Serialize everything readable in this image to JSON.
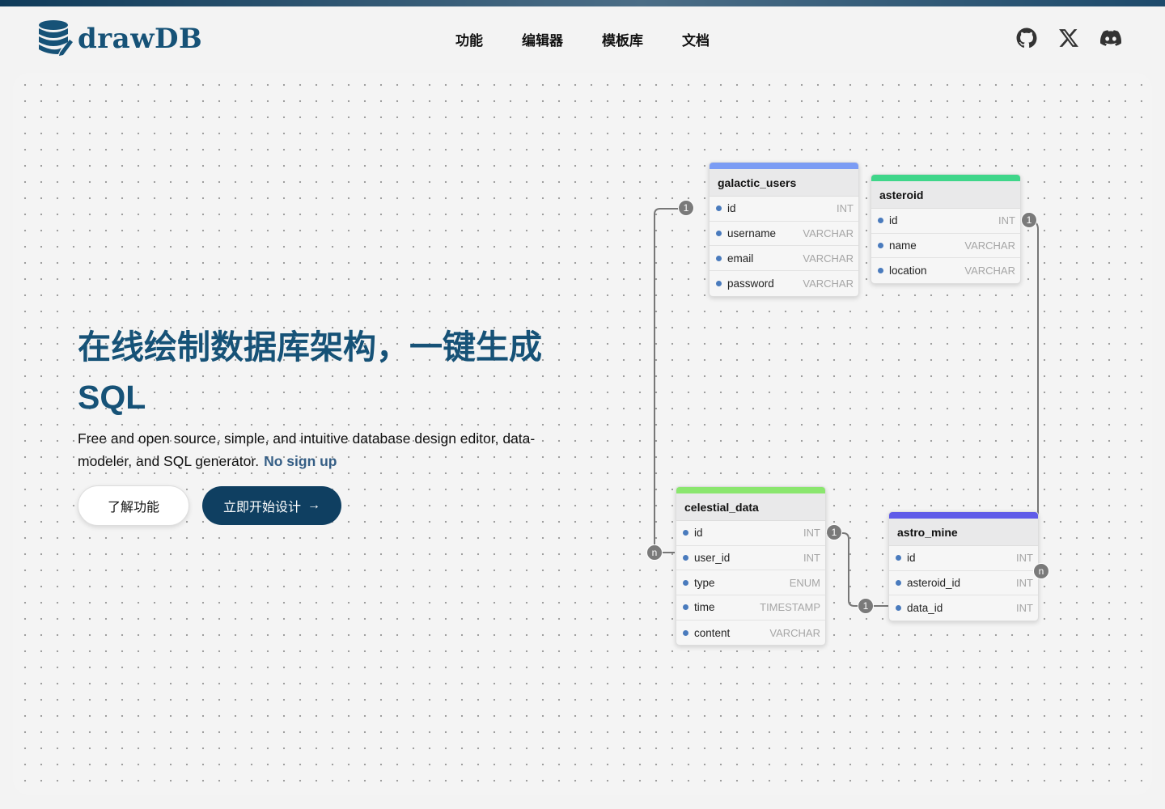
{
  "brand": {
    "name": "drawDB"
  },
  "nav": {
    "items": [
      "功能",
      "编辑器",
      "模板库",
      "文档"
    ]
  },
  "social": [
    "github-icon",
    "x-icon",
    "discord-icon"
  ],
  "hero": {
    "title": "在线绘制数据库架构，一键生成 SQL",
    "description": "Free and open source, simple, and intuitive database design editor, data-modeler, and SQL generator.",
    "highlight": "No sign up",
    "secondary_button": "了解功能",
    "primary_button": "立即开始设计"
  },
  "colors": {
    "brand": "#165277",
    "primary_button": "#0f3f61"
  },
  "diagram": {
    "tables": [
      {
        "name": "galactic_users",
        "color": "#7b9cf4",
        "fields": [
          {
            "name": "id",
            "type": "INT"
          },
          {
            "name": "username",
            "type": "VARCHAR"
          },
          {
            "name": "email",
            "type": "VARCHAR"
          },
          {
            "name": "password",
            "type": "VARCHAR"
          }
        ]
      },
      {
        "name": "asteroid",
        "color": "#3fd68a",
        "fields": [
          {
            "name": "id",
            "type": "INT"
          },
          {
            "name": "name",
            "type": "VARCHAR"
          },
          {
            "name": "location",
            "type": "VARCHAR"
          }
        ]
      },
      {
        "name": "celestial_data",
        "color": "#8ae66e",
        "fields": [
          {
            "name": "id",
            "type": "INT"
          },
          {
            "name": "user_id",
            "type": "INT"
          },
          {
            "name": "type",
            "type": "ENUM"
          },
          {
            "name": "time",
            "type": "TIMESTAMP"
          },
          {
            "name": "content",
            "type": "VARCHAR"
          }
        ]
      },
      {
        "name": "astro_mine",
        "color": "#5f5be8",
        "fields": [
          {
            "name": "id",
            "type": "INT"
          },
          {
            "name": "asteroid_id",
            "type": "INT"
          },
          {
            "name": "data_id",
            "type": "INT"
          }
        ]
      }
    ],
    "cardinality": {
      "one": "1",
      "many": "n"
    }
  }
}
